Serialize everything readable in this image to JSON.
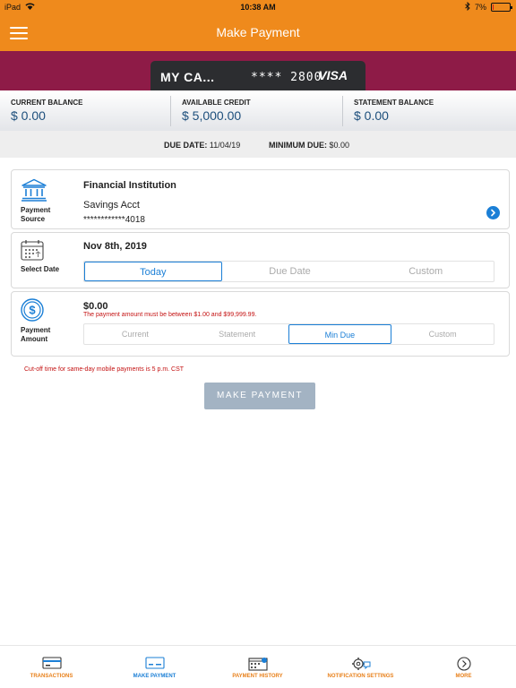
{
  "status_bar": {
    "device": "iPad",
    "time": "10:38 AM",
    "battery_percent": "7%",
    "battery_level": 0.07,
    "icons": [
      "wifi-icon",
      "bluetooth-icon",
      "battery-icon"
    ]
  },
  "header": {
    "title": "Make Payment",
    "menu_icon": "hamburger-menu-icon"
  },
  "card": {
    "name": "MY CA...",
    "masked_number": "**** 2800",
    "brand": "VISA"
  },
  "balances": [
    {
      "label": "CURRENT BALANCE",
      "value": "$ 0.00"
    },
    {
      "label": "AVAILABLE CREDIT",
      "value": "$ 5,000.00"
    },
    {
      "label": "STATEMENT BALANCE",
      "value": "$ 0.00"
    }
  ],
  "due": {
    "due_date_label": "DUE DATE:",
    "due_date_value": "11/04/19",
    "min_due_label": "MINIMUM DUE:",
    "min_due_value": "$0.00"
  },
  "payment_source": {
    "label_line1": "Payment",
    "label_line2": "Source",
    "icon": "bank-icon",
    "institution": "Financial Institution",
    "account_type": "Savings Acct",
    "account_number": "************4018",
    "action_icon": "chevron-right-circle-icon"
  },
  "select_date": {
    "label": "Select Date",
    "icon": "calendar-icon",
    "selected_date": "Nov 8th, 2019",
    "options": [
      "Today",
      "Due Date",
      "Custom"
    ],
    "active_index": 0
  },
  "payment_amount": {
    "label_line1": "Payment",
    "label_line2": "Amount",
    "icon": "dollar-circle-icon",
    "amount": "$0.00",
    "error": "The payment amount must be between $1.00 and $99,999.99.",
    "options": [
      "Current",
      "Statement",
      "Min Due",
      "Custom"
    ],
    "active_index": 2
  },
  "cutoff_note": "Cut-off time for same-day mobile payments is 5 p.m. CST",
  "make_payment_button": "MAKE PAYMENT",
  "colors": {
    "brand_orange": "#ef8a1c",
    "maroon": "#8e1b47",
    "accent_blue": "#1b7fd6",
    "error_red": "#c41212",
    "disabled_button": "#a3b3c3"
  },
  "tabs": [
    {
      "label": "TRANSACTIONS",
      "icon": "credit-card-icon"
    },
    {
      "label": "MAKE PAYMENT",
      "icon": "card-payment-icon"
    },
    {
      "label": "PAYMENT HISTORY",
      "icon": "calendar-history-icon"
    },
    {
      "label": "NOTIFICATION SETTINGS",
      "icon": "gear-chat-icon"
    },
    {
      "label": "MORE",
      "icon": "chevron-right-circle-icon"
    }
  ],
  "active_tab": 1
}
